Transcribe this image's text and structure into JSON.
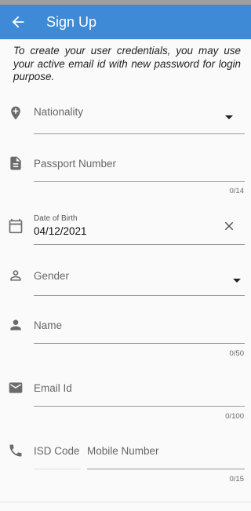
{
  "appbar": {
    "title": "Sign Up"
  },
  "intro": {
    "text": "To create your user credentials, you may use your active email id with new password for login purpose."
  },
  "fields": {
    "nationality": {
      "label": "Nationality"
    },
    "passport": {
      "label": "Passport Number",
      "counter": "0/14"
    },
    "dob": {
      "label": "Date of Birth",
      "value": "04/12/2021"
    },
    "gender": {
      "label": "Gender"
    },
    "name": {
      "label": "Name",
      "counter": "0/50"
    },
    "email": {
      "label": "Email Id",
      "counter": "0/100"
    },
    "isd": {
      "label": "ISD Code"
    },
    "mobile": {
      "label": "Mobile Number",
      "counter": "0/15"
    }
  },
  "colors": {
    "appbar": "#3f8ad6",
    "icon": "#6b6b6b"
  },
  "icons": {
    "back": "arrow-back-icon",
    "nationality": "location-pin-icon",
    "passport": "document-icon",
    "dob": "calendar-icon",
    "clear": "close-icon",
    "gender": "person-outline-icon",
    "name": "person-icon",
    "email": "mail-icon",
    "mobile": "phone-icon"
  }
}
